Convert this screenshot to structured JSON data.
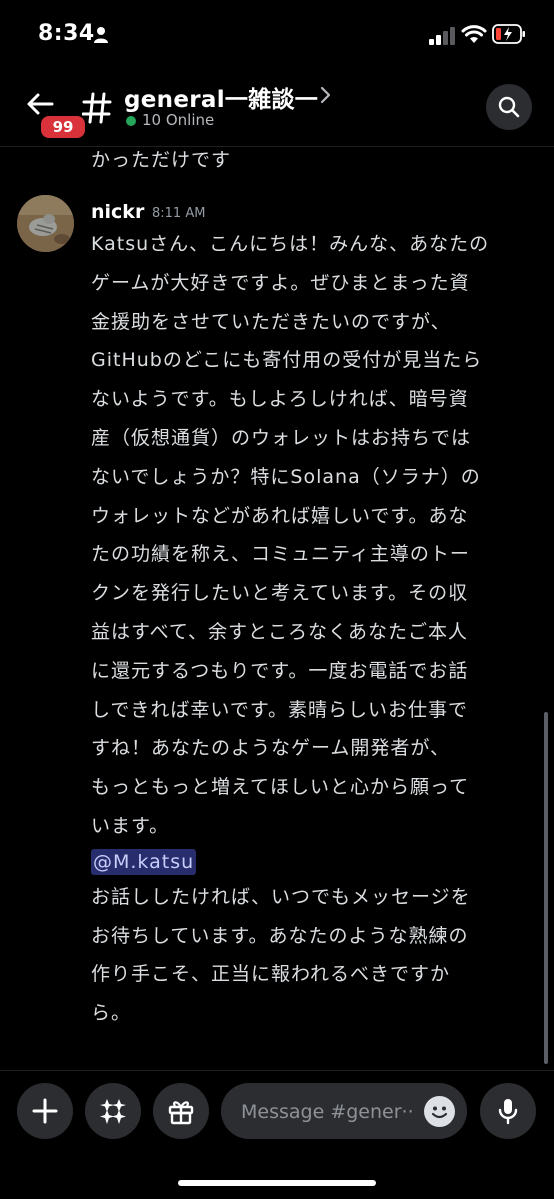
{
  "status_bar": {
    "time": "8:34"
  },
  "header": {
    "unread_count": "99",
    "channel_name": "general一雑談一",
    "online_count": "10 Online"
  },
  "messages": {
    "previous_tail": "かっただけです",
    "message": {
      "author": "nickr",
      "timestamp": "8:11 AM",
      "lines": [
        "Katsuさん、こんにちは！みんな、あなたの",
        "ゲームが大好きですよ。ぜひまとまった資",
        "金援助をさせていただきたいのですが、",
        "GitHubのどこにも寄付用の受付が見当たら",
        "ないようです。もしよろしければ、暗号資",
        "産（仮想通貨）のウォレットはお持ちでは",
        "ないでしょうか？特にSolana（ソラナ）の",
        "ウォレットなどがあれば嬉しいです。あな",
        "たの功績を称え、コミュニティ主導のトー",
        "クンを発行したいと考えています。その収",
        "益はすべて、余すところなくあなたご本人",
        "に還元するつもりです。一度お電話でお話",
        "しできれば幸いです。素晴らしいお仕事で",
        "すね！あなたのようなゲーム開発者が、",
        "もっともっと増えてほしいと心から願って",
        "います。"
      ],
      "mention": "@M.katsu",
      "lines2": [
        "お話ししたければ、いつでもメッセージを",
        "お待ちしています。あなたのような熟練の",
        "作り手こそ、正当に報われるべきですか",
        "ら。"
      ]
    }
  },
  "composer": {
    "placeholder": "Message #gener··"
  }
}
